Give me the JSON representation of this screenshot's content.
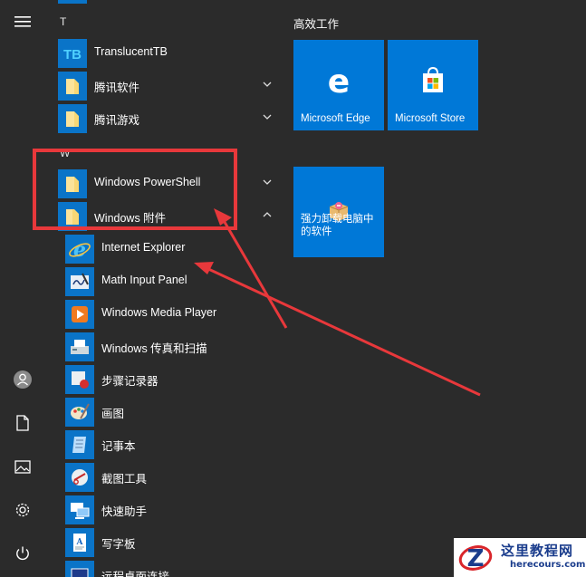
{
  "app_list": {
    "letters": [
      "T",
      "W"
    ],
    "items": [
      {
        "label": "TranslucentTB",
        "icon": "translucenttb-icon",
        "level": 1,
        "chevron": "",
        "tile_color": "#0a74c8"
      },
      {
        "label": "腾讯软件",
        "icon": "folder-icon",
        "level": 1,
        "chevron": "down",
        "tile_color": "#0a74c8"
      },
      {
        "label": "腾讯游戏",
        "icon": "folder-icon",
        "level": 1,
        "chevron": "down",
        "tile_color": "#0a74c8"
      },
      {
        "label": "Windows PowerShell",
        "icon": "folder-icon",
        "level": 1,
        "chevron": "down",
        "tile_color": "#0a74c8"
      },
      {
        "label": "Windows 附件",
        "icon": "folder-icon",
        "level": 1,
        "chevron": "up",
        "tile_color": "#0a74c8"
      },
      {
        "label": "Internet Explorer",
        "icon": "internet-explorer-icon",
        "level": 2,
        "chevron": "",
        "tile_color": "#0a74c8"
      },
      {
        "label": "Math Input Panel",
        "icon": "math-input-panel-icon",
        "level": 2,
        "chevron": "",
        "tile_color": "#0a74c8"
      },
      {
        "label": "Windows Media Player",
        "icon": "media-player-icon",
        "level": 2,
        "chevron": "",
        "tile_color": "#0a74c8"
      },
      {
        "label": "Windows 传真和扫描",
        "icon": "fax-scan-icon",
        "level": 2,
        "chevron": "",
        "tile_color": "#0a74c8"
      },
      {
        "label": "步骤记录器",
        "icon": "steps-recorder-icon",
        "level": 2,
        "chevron": "",
        "tile_color": "#0a74c8"
      },
      {
        "label": "画图",
        "icon": "paint-icon",
        "level": 2,
        "chevron": "",
        "tile_color": "#0a74c8"
      },
      {
        "label": "记事本",
        "icon": "notepad-icon",
        "level": 2,
        "chevron": "",
        "tile_color": "#0a74c8"
      },
      {
        "label": "截图工具",
        "icon": "snipping-tool-icon",
        "level": 2,
        "chevron": "",
        "tile_color": "#0a74c8"
      },
      {
        "label": "快速助手",
        "icon": "quick-assist-icon",
        "level": 2,
        "chevron": "",
        "tile_color": "#0a74c8"
      },
      {
        "label": "写字板",
        "icon": "wordpad-icon",
        "level": 2,
        "chevron": "",
        "tile_color": "#0a74c8"
      },
      {
        "label": "远程桌面连接",
        "icon": "remote-desktop-icon",
        "level": 2,
        "chevron": "",
        "tile_color": "#0a74c8"
      }
    ]
  },
  "tiles": {
    "group_title": "高效工作",
    "items": [
      {
        "label": "Microsoft Edge",
        "icon": "edge-icon"
      },
      {
        "label": "Microsoft Store",
        "icon": "store-icon"
      },
      {
        "label": "强力卸载电脑中的软件",
        "icon": "uninstall-box-icon"
      }
    ]
  },
  "rail": {
    "icons": [
      "hamburger-menu-icon",
      "user-avatar-icon",
      "documents-icon",
      "pictures-icon",
      "settings-gear-icon",
      "power-icon"
    ]
  },
  "annotations": {
    "highlight_color": "#e8383b",
    "arrow_color": "#e8383b"
  },
  "watermark": {
    "title": "这里教程网",
    "url": "herecours.com"
  },
  "colors": {
    "background": "#2b2b2b",
    "tile_blue": "#0078d7",
    "folder_yellow": "#f8d775"
  }
}
